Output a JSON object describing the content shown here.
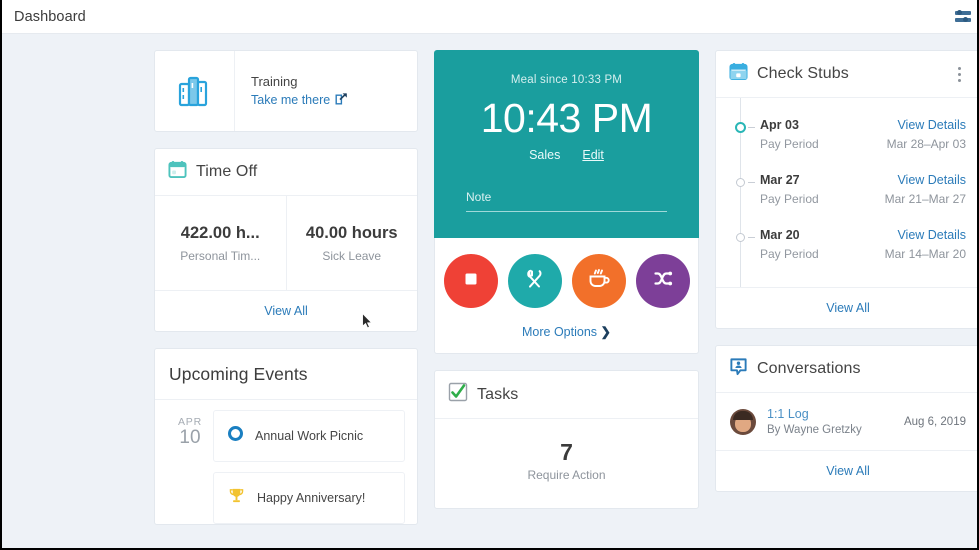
{
  "topbar": {
    "title": "Dashboard",
    "settings_icon": "sliders-icon"
  },
  "training": {
    "icon": "books-icon",
    "name": "Training",
    "link_label": "Take me there",
    "link_icon": "external-link-icon"
  },
  "time_off": {
    "icon": "calendar-icon",
    "title": "Time Off",
    "stats": [
      {
        "value": "422.00 h...",
        "label": "Personal Tim..."
      },
      {
        "value": "40.00 hours",
        "label": "Sick Leave"
      }
    ],
    "view_all": "View All"
  },
  "upcoming_events": {
    "title": "Upcoming Events",
    "events": [
      {
        "month": "APR",
        "day": "10",
        "icon": "circle-icon",
        "text": "Annual Work Picnic"
      },
      {
        "month": "",
        "day": "",
        "icon": "trophy-icon",
        "text": "Happy Anniversary!"
      }
    ]
  },
  "punch": {
    "since_label": "Meal since 10:33 PM",
    "current_time": "10:43 PM",
    "department": "Sales",
    "edit_label": "Edit",
    "note_placeholder": "Note",
    "accent_color": "#1a9e9e",
    "actions": [
      {
        "name": "stop-button",
        "icon": "stop-icon",
        "color": "#ef4136"
      },
      {
        "name": "meal-button",
        "icon": "utensils-icon",
        "color": "#1faaaa"
      },
      {
        "name": "break-button",
        "icon": "coffee-icon",
        "color": "#f2702a"
      },
      {
        "name": "transfer-button",
        "icon": "shuffle-icon",
        "color": "#7d3f98"
      }
    ],
    "more_options": "More Options",
    "more_options_icon": "chevron-right-icon"
  },
  "tasks": {
    "icon": "checkbox-checked-icon",
    "title": "Tasks",
    "count": "7",
    "label": "Require Action"
  },
  "check_stubs": {
    "icon": "calendar-blue-icon",
    "title": "Check Stubs",
    "menu_icon": "kebab-menu-icon",
    "rows": [
      {
        "date": "Apr 03",
        "action": "View Details",
        "sub": "Pay Period",
        "range": "Mar 28–Apr 03",
        "current": true
      },
      {
        "date": "Mar 27",
        "action": "View Details",
        "sub": "Pay Period",
        "range": "Mar 21–Mar 27",
        "current": false
      },
      {
        "date": "Mar 20",
        "action": "View Details",
        "sub": "Pay Period",
        "range": "Mar 14–Mar 20",
        "current": false
      }
    ],
    "view_all": "View All"
  },
  "conversations": {
    "icon": "conversation-icon",
    "title": "Conversations",
    "items": [
      {
        "avatar": "user-avatar",
        "title": "1:1 Log",
        "by": "By Wayne Gretzky",
        "date": "Aug 6, 2019"
      }
    ],
    "view_all": "View All"
  }
}
